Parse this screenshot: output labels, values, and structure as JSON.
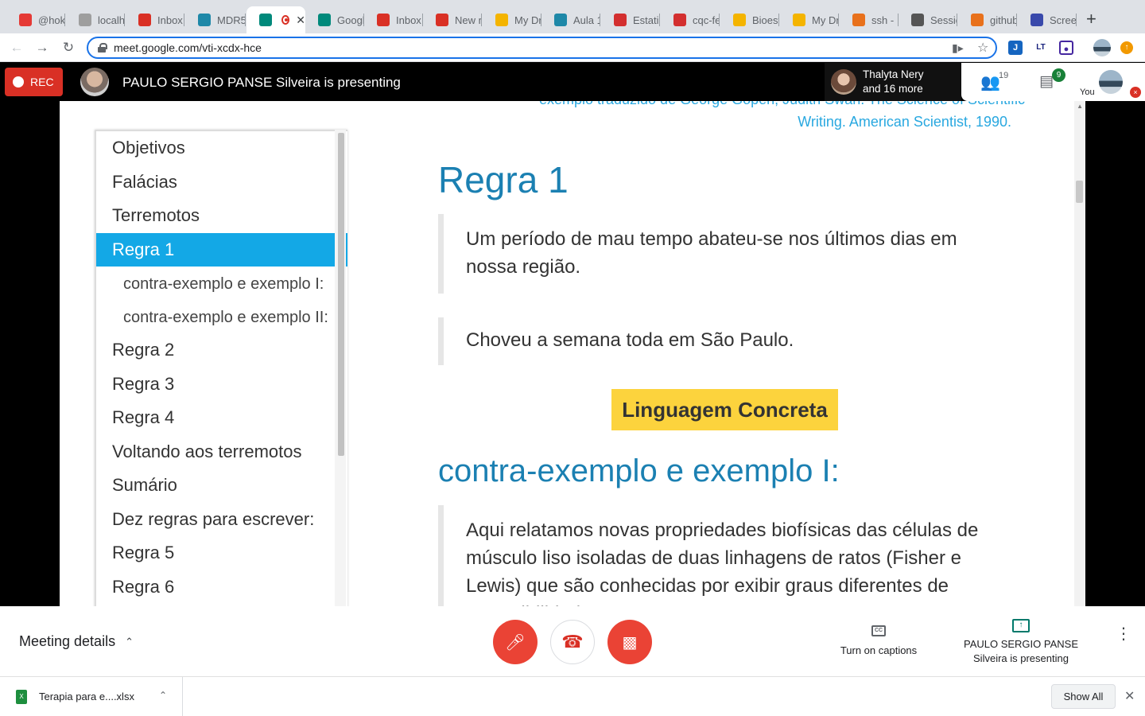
{
  "browser": {
    "tabs": [
      {
        "label": "@hok",
        "icon": "red-n",
        "color": "#e53935"
      },
      {
        "label": "localh",
        "icon": "globe",
        "color": "#9e9e9e"
      },
      {
        "label": "Inbox",
        "icon": "gmail",
        "color": "#d93025"
      },
      {
        "label": "MDR5",
        "icon": "classroom",
        "color": "#1e88a8"
      },
      {
        "label": "",
        "icon": "meet",
        "color": "#00897b",
        "active": true
      },
      {
        "label": "Googl",
        "icon": "meet",
        "color": "#00897b"
      },
      {
        "label": "Inbox",
        "icon": "gmail",
        "color": "#d93025"
      },
      {
        "label": "New n",
        "icon": "gmail",
        "color": "#d93025"
      },
      {
        "label": "My Dr",
        "icon": "drive",
        "color": "#f4b400"
      },
      {
        "label": "Aula 1",
        "icon": "classroom",
        "color": "#1e88a8"
      },
      {
        "label": "Estati",
        "icon": "pdf",
        "color": "#d32f2f"
      },
      {
        "label": "cqc-fe",
        "icon": "film",
        "color": "#d32f2f"
      },
      {
        "label": "Bioest",
        "icon": "drive",
        "color": "#f4b400"
      },
      {
        "label": "My Dr",
        "icon": "drive",
        "color": "#f4b400"
      },
      {
        "label": "ssh -",
        "icon": "stack",
        "color": "#e8711c"
      },
      {
        "label": "Sessic",
        "icon": "github",
        "color": "#555555"
      },
      {
        "label": "github",
        "icon": "stack",
        "color": "#e8711c"
      },
      {
        "label": "Scree",
        "icon": "screen",
        "color": "#3949ab"
      }
    ],
    "url": "meet.google.com/vti-xcdx-hce"
  },
  "meet": {
    "rec_label": "REC",
    "presenting_text": "PAULO SERGIO PANSE Silveira is presenting",
    "participant_name": "Thalyta Nery",
    "participant_more": "and 16 more",
    "people_count": "19",
    "chat_count": "9",
    "you_label": "You"
  },
  "slide": {
    "citation_top": "exemplo traduzido de George Gopen, Judith Swan. The Science of Scientific",
    "citation": "Writing. American Scientist, 1990.",
    "toc": [
      {
        "label": "Objetivos"
      },
      {
        "label": "Falácias"
      },
      {
        "label": "Terremotos"
      },
      {
        "label": "Regra 1",
        "selected": true
      },
      {
        "label": "contra-exemplo e exemplo I:",
        "sub": true
      },
      {
        "label": "contra-exemplo e exemplo II:",
        "sub": true
      },
      {
        "label": "Regra 2"
      },
      {
        "label": "Regra 3"
      },
      {
        "label": "Regra 4"
      },
      {
        "label": "Voltando aos terremotos"
      },
      {
        "label": "Sumário"
      },
      {
        "label": "Dez regras para escrever:"
      },
      {
        "label": "Regra 5"
      },
      {
        "label": "Regra 6"
      }
    ],
    "heading": "Regra 1",
    "quote1": "Um período de mau tempo abateu-se nos últimos dias em nossa região.",
    "quote2": "Choveu a semana toda em São Paulo.",
    "badge": "Linguagem Concreta",
    "subheading": "contra-exemplo e exemplo I:",
    "quote3": "Aqui relatamos novas propriedades biofísicas das células de músculo liso isoladas de duas linhagens de ratos (Fisher e Lewis) que são conhecidas por exibir graus diferentes de suscetibilidade..."
  },
  "controls": {
    "meeting_details": "Meeting details",
    "captions": "Turn on captions",
    "presenting": "PAULO SERGIO PANSE Silveira is presenting"
  },
  "downloads": {
    "file": "Terapia para e....xlsx",
    "show_all": "Show All"
  }
}
